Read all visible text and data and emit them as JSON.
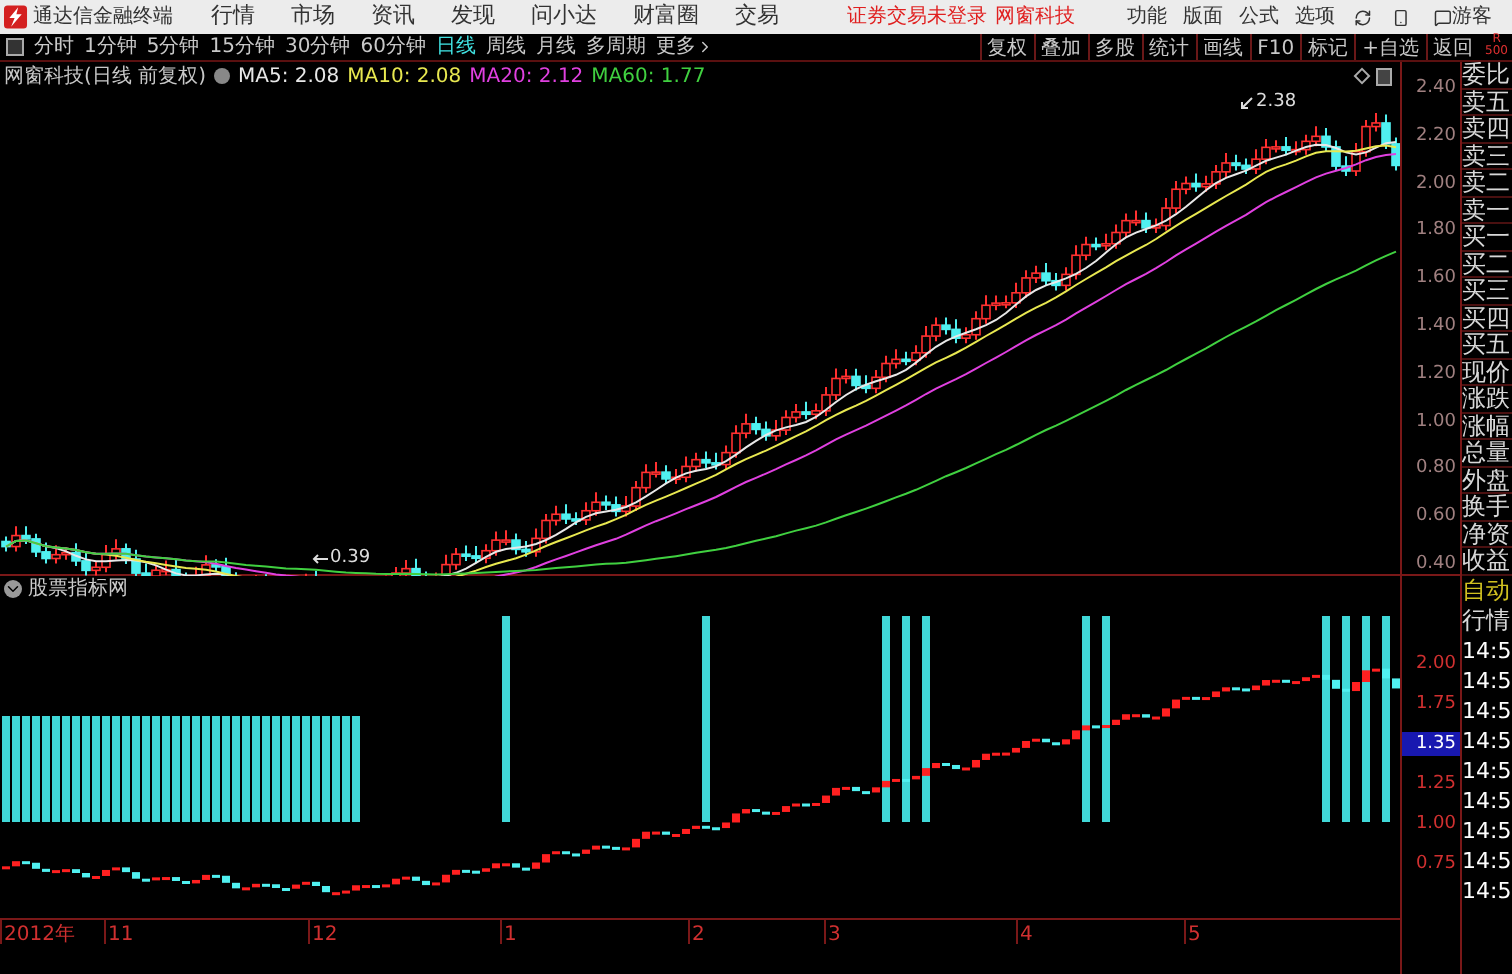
{
  "title_bar": {
    "app_name": "通达信金融终端",
    "menus": [
      "行情",
      "市场",
      "资讯",
      "发现",
      "问小达",
      "财富圈",
      "交易"
    ],
    "notices": [
      "证券交易未登录",
      "网窗科技"
    ],
    "right_menus": [
      "功能",
      "版面",
      "公式",
      "选项"
    ],
    "user": "游客"
  },
  "period_tabs": [
    {
      "label": "分时",
      "selected": false
    },
    {
      "label": "1分钟",
      "selected": false
    },
    {
      "label": "5分钟",
      "selected": false
    },
    {
      "label": "15分钟",
      "selected": false
    },
    {
      "label": "30分钟",
      "selected": false
    },
    {
      "label": "60分钟",
      "selected": false
    },
    {
      "label": "日线",
      "selected": true
    },
    {
      "label": "周线",
      "selected": false
    },
    {
      "label": "月线",
      "selected": false
    },
    {
      "label": "多周期",
      "selected": false
    },
    {
      "label": "更多",
      "selected": false
    }
  ],
  "tool_buttons": [
    "复权",
    "叠加",
    "多股",
    "统计",
    "画线",
    "F10",
    "标记",
    "+自选",
    "返回"
  ],
  "corner_mark": {
    "letter": "R",
    "value": "500"
  },
  "chart_info": {
    "stock": "网窗科技(日线 前复权)",
    "averages": [
      {
        "label": "MA5: 2.08",
        "color": "#e8e8e8"
      },
      {
        "label": "MA10: 2.08",
        "color": "#e8e850"
      },
      {
        "label": "MA20: 2.12",
        "color": "#e040e0"
      },
      {
        "label": "MA60: 1.77",
        "color": "#40d040"
      }
    ]
  },
  "price_axis": [
    "2.40",
    "2.20",
    "2.00",
    "1.80",
    "1.60",
    "1.40",
    "1.20",
    "1.00",
    "0.80",
    "0.60",
    "0.40"
  ],
  "price_marks": {
    "high": "2.38",
    "low": "0.39"
  },
  "quote_labels": [
    "委比",
    "卖五",
    "卖四",
    "卖三",
    "卖二",
    "卖一",
    "买一",
    "买二",
    "买三",
    "买四",
    "买五",
    "现价",
    "涨跌",
    "涨幅",
    "总量",
    "外盘",
    "换手",
    "净资",
    "收益"
  ],
  "indicator": {
    "title": "股票指标网",
    "axis": [
      {
        "label": "2.00",
        "selected": false
      },
      {
        "label": "1.75",
        "selected": false
      },
      {
        "label": "1.35",
        "selected": true
      },
      {
        "label": "1.25",
        "selected": false
      },
      {
        "label": "1.00",
        "selected": false
      },
      {
        "label": "0.75",
        "selected": false
      }
    ]
  },
  "tick_panel": {
    "header": [
      "自动",
      "行情"
    ],
    "times": [
      "14:5",
      "14:5",
      "14:5",
      "14:5",
      "14:5",
      "14:5",
      "14:5",
      "14:5",
      "14:5"
    ]
  },
  "date_axis": [
    "2012年",
    "11",
    "12",
    "1",
    "2",
    "3",
    "4",
    "5"
  ]
}
